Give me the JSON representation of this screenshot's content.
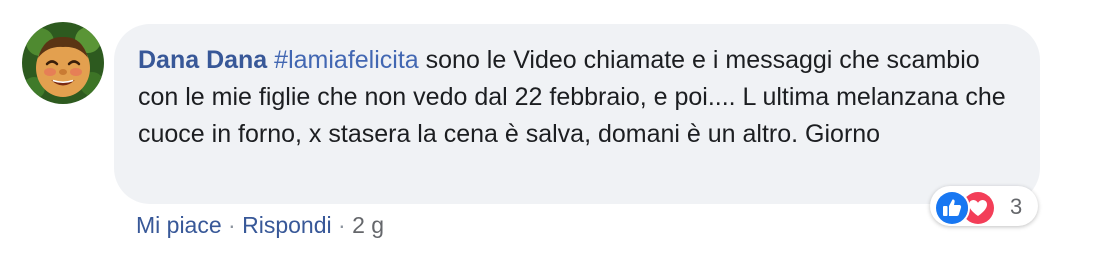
{
  "comment": {
    "author": "Dana Dana",
    "hashtag": "#lamiafelicita",
    "body": " sono le Video chiamate e i messaggi che scambio con le mie figlie che non vedo dal 22 febbraio, e poi.... L ultima melanzana che cuoce in forno, x stasera la cena è salva, domani è un altro. Giorno",
    "avatar_icon": "smiling-face-avatar"
  },
  "reactions": {
    "icons": [
      "like-icon",
      "love-icon"
    ],
    "like_color": "#1877f2",
    "love_color": "#f33e58",
    "count": "3"
  },
  "actions": {
    "like_label": "Mi piace",
    "separator": "·",
    "reply_label": "Rispondi",
    "time": "2 g"
  },
  "colors": {
    "bubble": "#f0f2f5",
    "link": "#385898",
    "text": "#1c1e21",
    "meta": "#65676b"
  }
}
